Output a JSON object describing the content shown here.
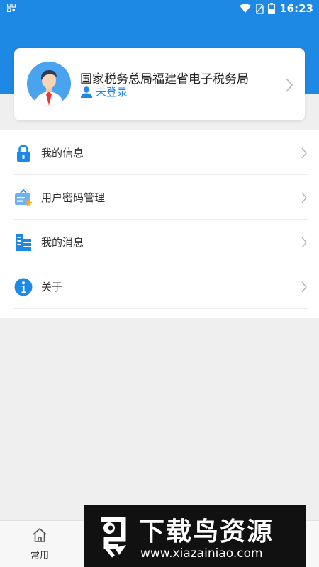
{
  "status_bar": {
    "time": "16:23",
    "icons": [
      "notification-icon",
      "wifi-icon",
      "no-sim-icon",
      "battery-icon"
    ],
    "background_color": "#1e88e5"
  },
  "profile": {
    "org_name": "国家税务总局福建省电子税务局",
    "login_status": "未登录",
    "accent_color": "#1e88e5"
  },
  "menu": {
    "items": [
      {
        "label": "我的信息",
        "icon": "lock-icon"
      },
      {
        "label": "用户密码管理",
        "icon": "password-card-icon"
      },
      {
        "label": "我的消息",
        "icon": "message-list-icon"
      },
      {
        "label": "关于",
        "icon": "info-icon"
      }
    ]
  },
  "bottom_nav": {
    "home_label": "常用"
  },
  "watermark": {
    "title": "下载鸟资源",
    "url": "www.xiazainiao.com"
  }
}
